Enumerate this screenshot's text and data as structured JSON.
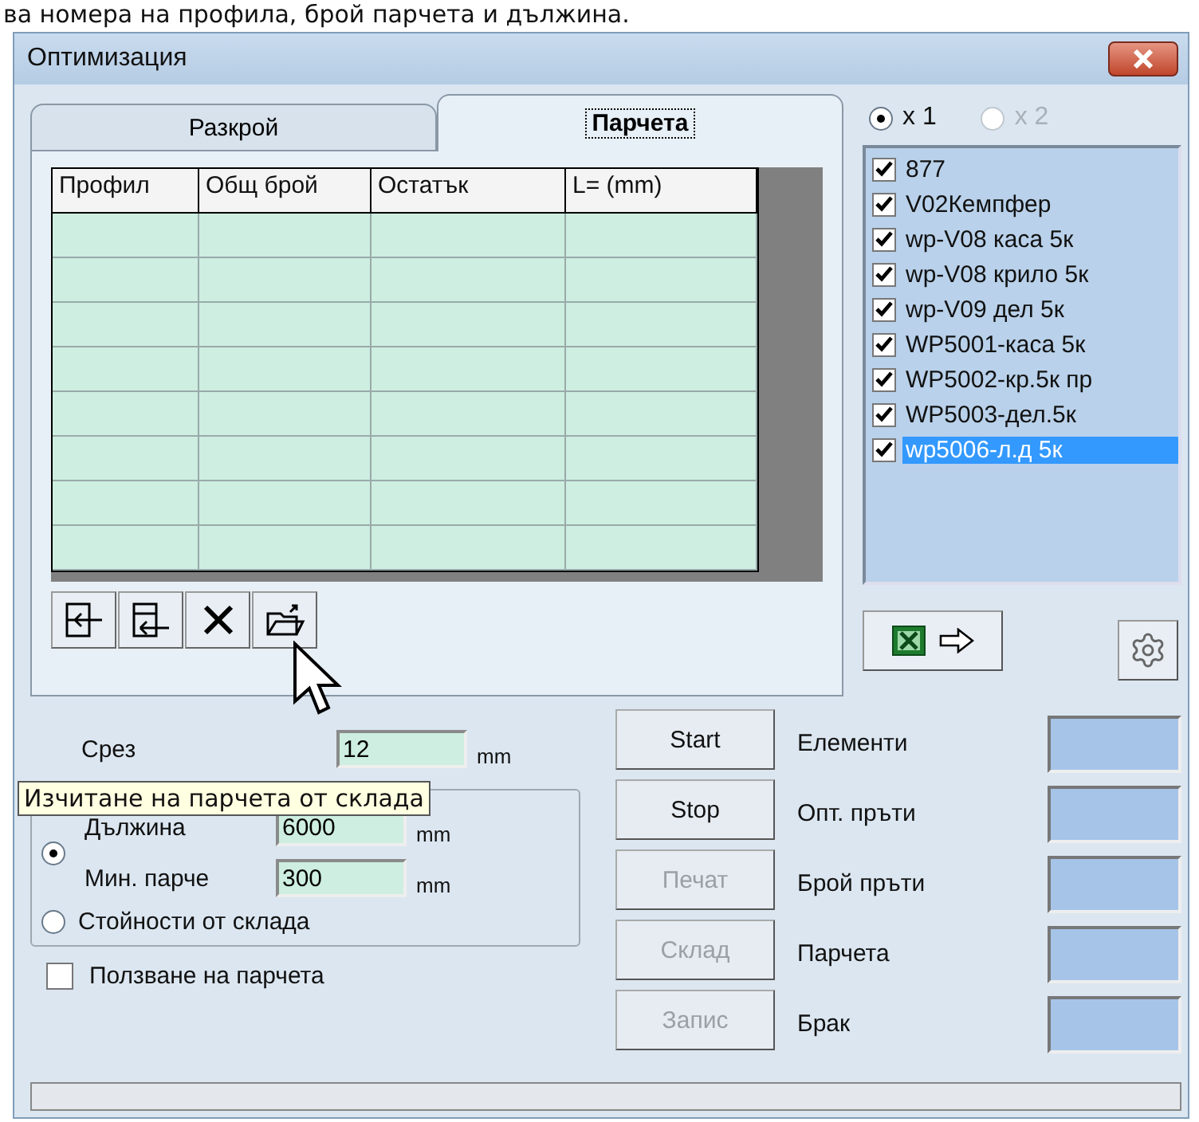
{
  "caption": "ва номера на профила, брой парчета и дължина.",
  "window": {
    "title": "Оптимизация"
  },
  "tabs": [
    {
      "label": "Разкрой",
      "selected": false
    },
    {
      "label": "Парчета",
      "selected": true
    }
  ],
  "table": {
    "columns": [
      "Профил",
      "Общ брой",
      "Остатък",
      "L= (mm)"
    ]
  },
  "multiplier": [
    {
      "label": "x 1",
      "selected": true,
      "disabled": false
    },
    {
      "label": "x 2",
      "selected": false,
      "disabled": true
    }
  ],
  "profiles": [
    {
      "label": "877",
      "checked": true,
      "selected": false
    },
    {
      "label": "V02Кемпфер",
      "checked": true,
      "selected": false
    },
    {
      "label": "wp-V08 каса 5к",
      "checked": true,
      "selected": false
    },
    {
      "label": "wp-V08 крило 5к",
      "checked": true,
      "selected": false
    },
    {
      "label": "wp-V09 дел 5к",
      "checked": true,
      "selected": false
    },
    {
      "label": "WP5001-каса 5к",
      "checked": true,
      "selected": false
    },
    {
      "label": "WP5002-кр.5к пр",
      "checked": true,
      "selected": false
    },
    {
      "label": "WP5003-дел.5к",
      "checked": true,
      "selected": false
    },
    {
      "label": "wp5006-л.д  5к",
      "checked": true,
      "selected": true
    }
  ],
  "cut": {
    "label": "Срез",
    "value": "12",
    "unit": "mm"
  },
  "stock_options": [
    {
      "kind": "fields",
      "selected": true,
      "fields": [
        {
          "label": "Дължина",
          "value": "6000",
          "unit": "mm"
        },
        {
          "label": "Мин. парче",
          "value": "300",
          "unit": "mm"
        }
      ]
    },
    {
      "kind": "text",
      "selected": false,
      "label": "Стойности от склада"
    }
  ],
  "use_pieces": {
    "label": "Ползване на парчета",
    "checked": false
  },
  "actions": [
    {
      "label": "Start",
      "disabled": false
    },
    {
      "label": "Stop",
      "disabled": false
    },
    {
      "label": "Печат",
      "disabled": true
    },
    {
      "label": "Склад",
      "disabled": true
    },
    {
      "label": "Запис",
      "disabled": true
    }
  ],
  "results": [
    {
      "label": "Елементи"
    },
    {
      "label": "Опт. пръти"
    },
    {
      "label": "Брой пръти"
    },
    {
      "label": "Парчета"
    },
    {
      "label": "Брак"
    }
  ],
  "tooltip": "Изчитане на парчета от склада"
}
